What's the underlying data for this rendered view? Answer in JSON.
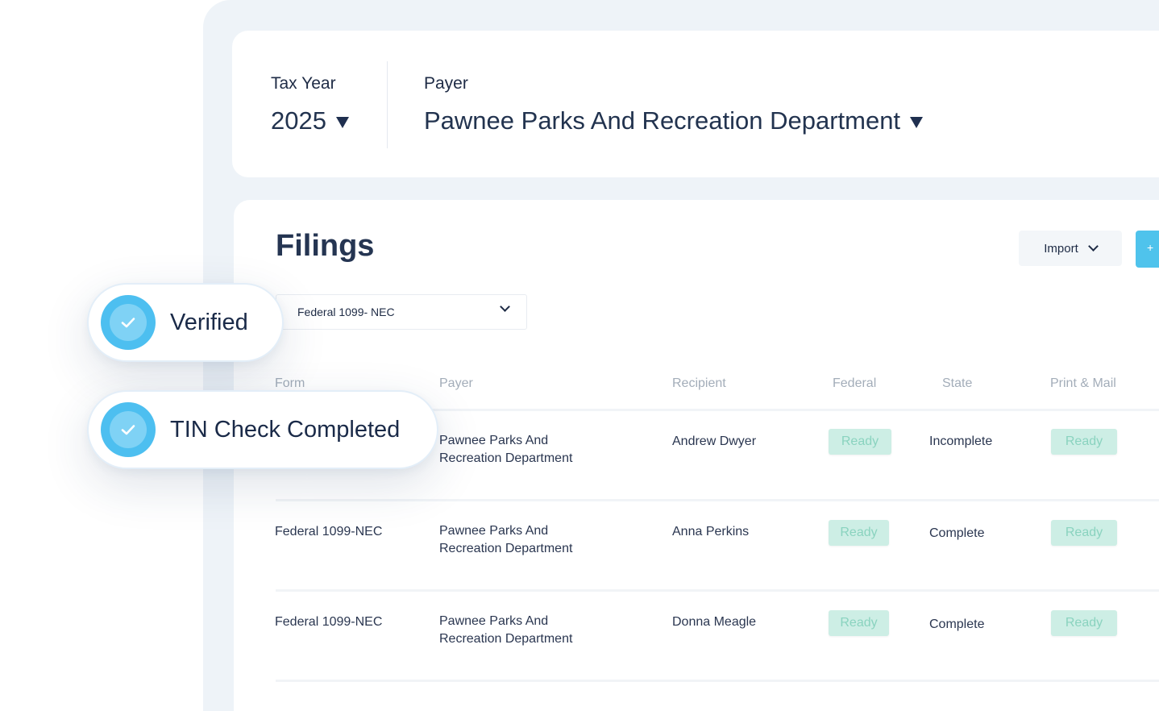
{
  "header": {
    "tax_year_label": "Tax Year",
    "tax_year_value": "2025",
    "payer_label": "Payer",
    "payer_value": "Pawnee Parks And Recreation Department"
  },
  "filings": {
    "title": "Filings",
    "import_label": "Import",
    "add_label": "+",
    "form_filter": "Federal 1099- NEC"
  },
  "table": {
    "columns": [
      "Form",
      "Payer",
      "Recipient",
      "Federal",
      "State",
      "Print & Mail"
    ],
    "rows": [
      {
        "form": "",
        "payer_line1": "Pawnee Parks And",
        "payer_line2": "Recreation Department",
        "recipient": "Andrew Dwyer",
        "federal": "Ready",
        "state": "Incomplete",
        "print_mail": "Ready"
      },
      {
        "form": "Federal 1099-NEC",
        "payer_line1": "Pawnee Parks And",
        "payer_line2": "Recreation Department",
        "recipient": "Anna Perkins",
        "federal": "Ready",
        "state": "Complete",
        "print_mail": "Ready"
      },
      {
        "form": "Federal 1099-NEC",
        "payer_line1": "Pawnee Parks And",
        "payer_line2": "Recreation Department",
        "recipient": "Donna Meagle",
        "federal": "Ready",
        "state": "Complete",
        "print_mail": "Ready"
      }
    ]
  },
  "badges": {
    "verified": "Verified",
    "tin_check": "TIN Check Completed"
  },
  "colors": {
    "accent": "#4fc3ec",
    "ready_bg": "#cdeee5",
    "ready_text": "#8ad3bf",
    "frame_bg": "#eef3f8"
  }
}
